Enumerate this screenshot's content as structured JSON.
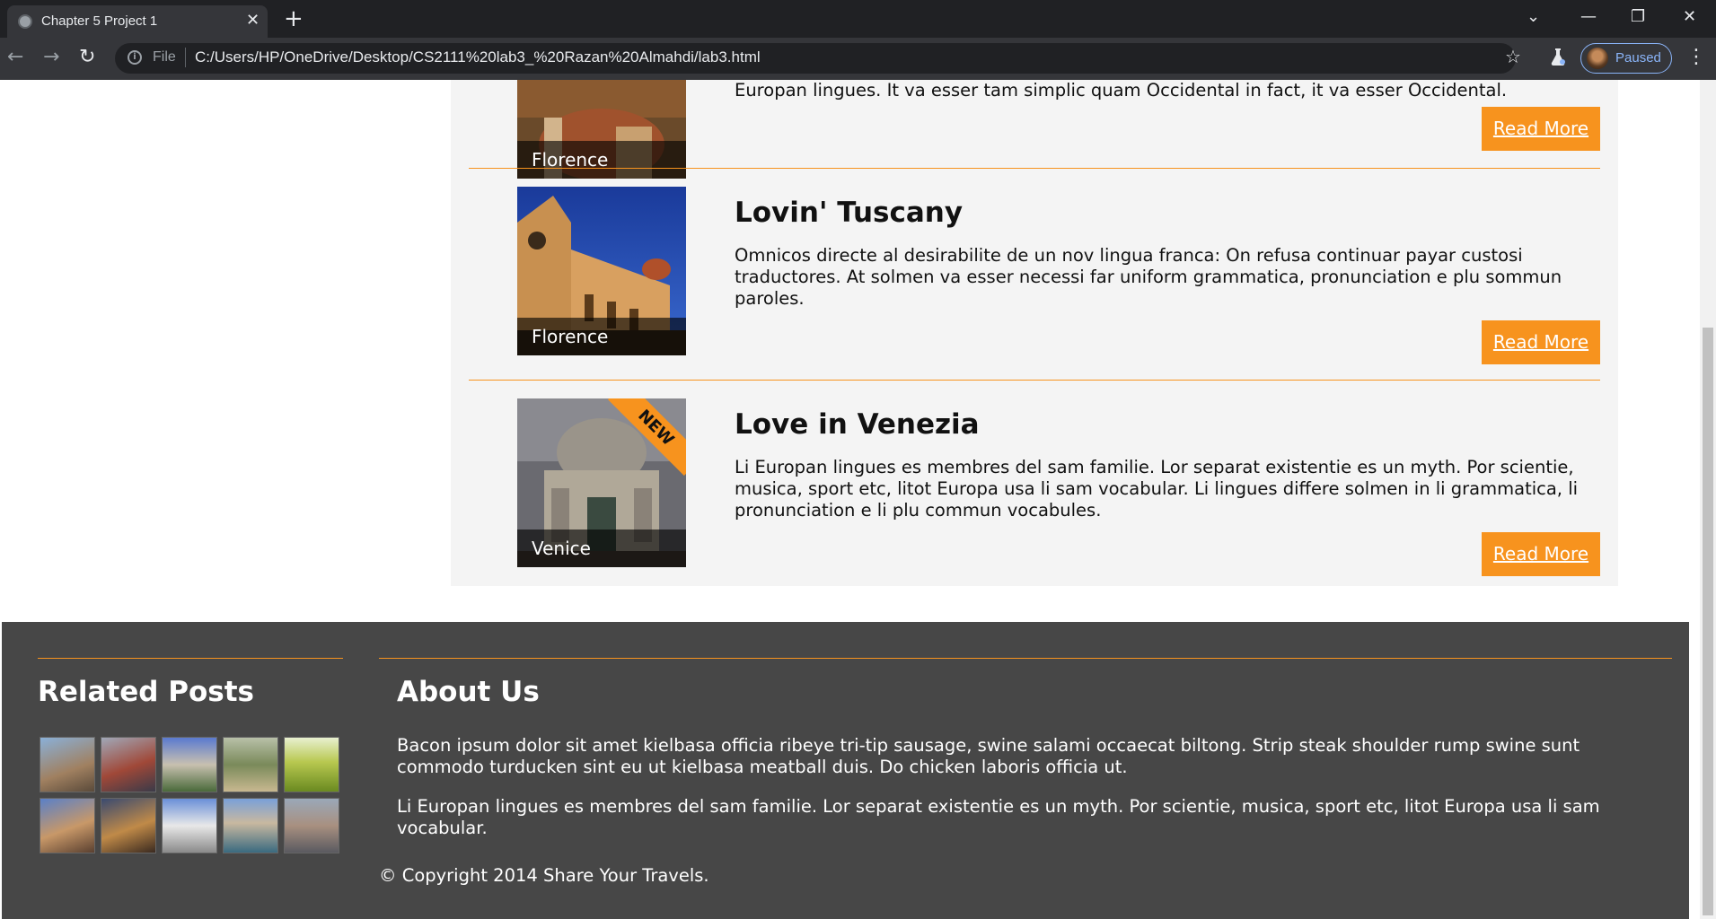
{
  "browser": {
    "tab_title": "Chapter 5 Project 1",
    "tab_close": "✕",
    "new_tab": "+",
    "url_scheme_label": "File",
    "url": "C:/Users/HP/OneDrive/Desktop/CS2111%20lab3_%20Razan%20Almahdi/lab3.html",
    "profile_status": "Paused",
    "icons": [
      "globe-icon",
      "close-icon",
      "plus-icon",
      "chevron-down-icon",
      "minimize-icon",
      "restore-icon",
      "back-icon",
      "forward-icon",
      "reload-icon",
      "info-icon",
      "star-icon",
      "labs-flask-icon",
      "menu-dots-icon"
    ]
  },
  "posts": [
    {
      "title": "",
      "partial_text": "Europan lingues. It va esser tam simplic quam Occidental in fact, it va esser Occidental.",
      "image_caption": "Florence",
      "read_more": "Read More"
    },
    {
      "title": "Lovin' Tuscany",
      "text": "Omnicos directe al desirabilite de un nov lingua franca: On refusa continuar payar custosi traductores. At solmen va esser necessi far uniform grammatica, pronunciation e plu sommun paroles.",
      "image_caption": "Florence",
      "read_more": "Read More"
    },
    {
      "title": "Love in Venezia",
      "text": "Li Europan lingues es membres del sam familie. Lor separat existentie es un myth. Por scientie, musica, sport etc, litot Europa usa li sam vocabular. Li lingues differe solmen in li grammatica, li pronunciation e li plu commun vocabules.",
      "image_caption": "Venice",
      "badge": "NEW",
      "read_more": "Read More"
    }
  ],
  "footer": {
    "related_heading": "Related Posts",
    "about_heading": "About Us",
    "about_p1": "Bacon ipsum dolor sit amet kielbasa officia ribeye tri-tip sausage, swine salami occaecat biltong. Strip steak shoulder rump swine sunt commodo turducken sint eu ut kielbasa meatball duis. Do chicken laboris officia ut.",
    "about_p2": "Li Europan lingues es membres del sam familie. Lor separat existentie es un myth. Por scientie, musica, sport etc, litot Europa usa li sam vocabular.",
    "copyright": "© Copyright 2014 Share Your Travels."
  },
  "colors": {
    "accent": "#f7931e",
    "footer_bg": "#474747",
    "panel_bg": "#f4f4f4",
    "chrome_dark": "#202124",
    "chrome_mid": "#35363a"
  }
}
